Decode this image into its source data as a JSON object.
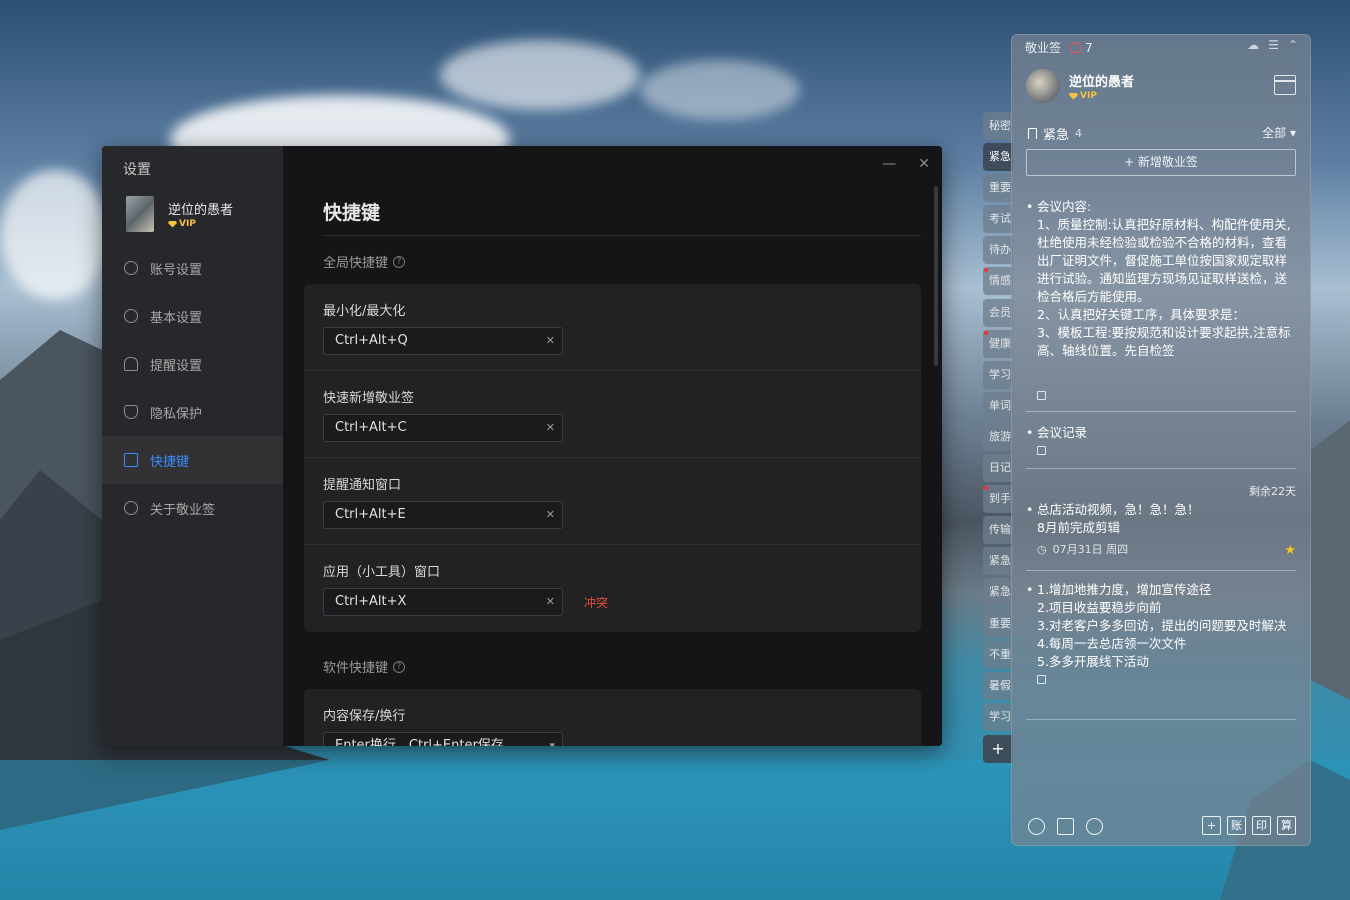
{
  "settings": {
    "window_title": "设置",
    "user": {
      "name": "逆位的愚者",
      "badge": "VIP"
    },
    "nav": [
      {
        "label": "账号设置",
        "icon": "user-icon"
      },
      {
        "label": "基本设置",
        "icon": "gear-icon"
      },
      {
        "label": "提醒设置",
        "icon": "bell-icon"
      },
      {
        "label": "隐私保护",
        "icon": "shield-icon"
      },
      {
        "label": "快捷键",
        "icon": "keyboard-icon",
        "active": true
      },
      {
        "label": "关于敬业签",
        "icon": "info-icon"
      }
    ],
    "page_title": "快捷键",
    "global_section": "全局快捷键",
    "global_shortcuts": [
      {
        "label": "最小化/最大化",
        "value": "Ctrl+Alt+Q"
      },
      {
        "label": "快速新增敬业签",
        "value": "Ctrl+Alt+C"
      },
      {
        "label": "提醒通知窗口",
        "value": "Ctrl+Alt+E"
      },
      {
        "label": "应用（小工具）窗口",
        "value": "Ctrl+Alt+X",
        "conflict": "冲突"
      }
    ],
    "software_section": "软件快捷键",
    "software_shortcuts": [
      {
        "label": "内容保存/换行",
        "value": "Enter换行，Ctrl+Enter保存"
      }
    ],
    "controls": {
      "minimize": "—",
      "close": "✕"
    }
  },
  "tabs": [
    "秘密",
    "紧急",
    "重要",
    "考试",
    "待办",
    "情感",
    "会员",
    "健康",
    "学习",
    "单词",
    "旅游",
    "日记",
    "到手",
    "传输",
    "紧急",
    "紧急",
    "重要",
    "不重",
    "暑假",
    "学习"
  ],
  "tabs_add": "+",
  "notes": {
    "app_name": "敬业签",
    "reminder_count": "7",
    "user": {
      "name": "逆位的愚者",
      "badge": "VIP"
    },
    "category": "紧急",
    "category_count": "4",
    "filter": "全部",
    "add_label": "+ 新增敬业签",
    "items": [
      {
        "text": "会议内容:\n1、质量控制:认真把好原材料、构配件使用关,杜绝使用未经检验或检验不合格的材料，查看出厂证明文件，督促施工单位按国家规定取样进行试验。通知监理方现场见证取样送检，送检合格后方能使用。\n2、认真把好关键工序，具体要求是：\n3、模板工程:要按规范和设计要求起拱,注意标高、轴线位置。先自检签"
      },
      {
        "text": "会议记录"
      },
      {
        "text": "总店活动视频，急！急！急！\n8月前完成剪辑",
        "remain": "剩余22天",
        "date": "07月31日 周四"
      },
      {
        "text": "1.增加地推力度，增加宣传途径\n2.项目收益要稳步向前\n3.对老客户多多回访，提出的问题要及时解决\n4.每周一去总店领一次文件\n5.多多开展线下活动"
      }
    ],
    "bottom_right": [
      "+",
      "账",
      "印",
      "算"
    ]
  }
}
